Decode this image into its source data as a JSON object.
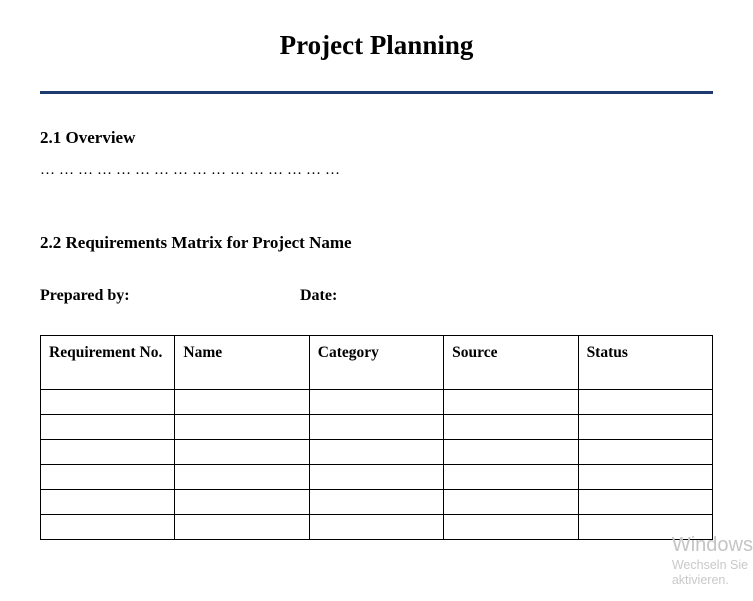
{
  "title": "Project Planning",
  "sections": {
    "overview": {
      "heading": "2.1 Overview",
      "placeholder": "…………………………………………"
    },
    "matrix": {
      "heading": "2.2 Requirements Matrix for Project Name",
      "prepared_by_label": "Prepared by:",
      "date_label": "Date:",
      "columns": [
        "Requirement No.",
        "Name",
        "Category",
        "Source",
        "Status"
      ],
      "rows": [
        [
          "",
          "",
          "",
          "",
          ""
        ],
        [
          "",
          "",
          "",
          "",
          ""
        ],
        [
          "",
          "",
          "",
          "",
          ""
        ],
        [
          "",
          "",
          "",
          "",
          ""
        ],
        [
          "",
          "",
          "",
          "",
          ""
        ],
        [
          "",
          "",
          "",
          "",
          ""
        ]
      ]
    }
  },
  "watermark": {
    "title": "Windows",
    "line1": "Wechseln Sie",
    "line2": "aktivieren."
  }
}
